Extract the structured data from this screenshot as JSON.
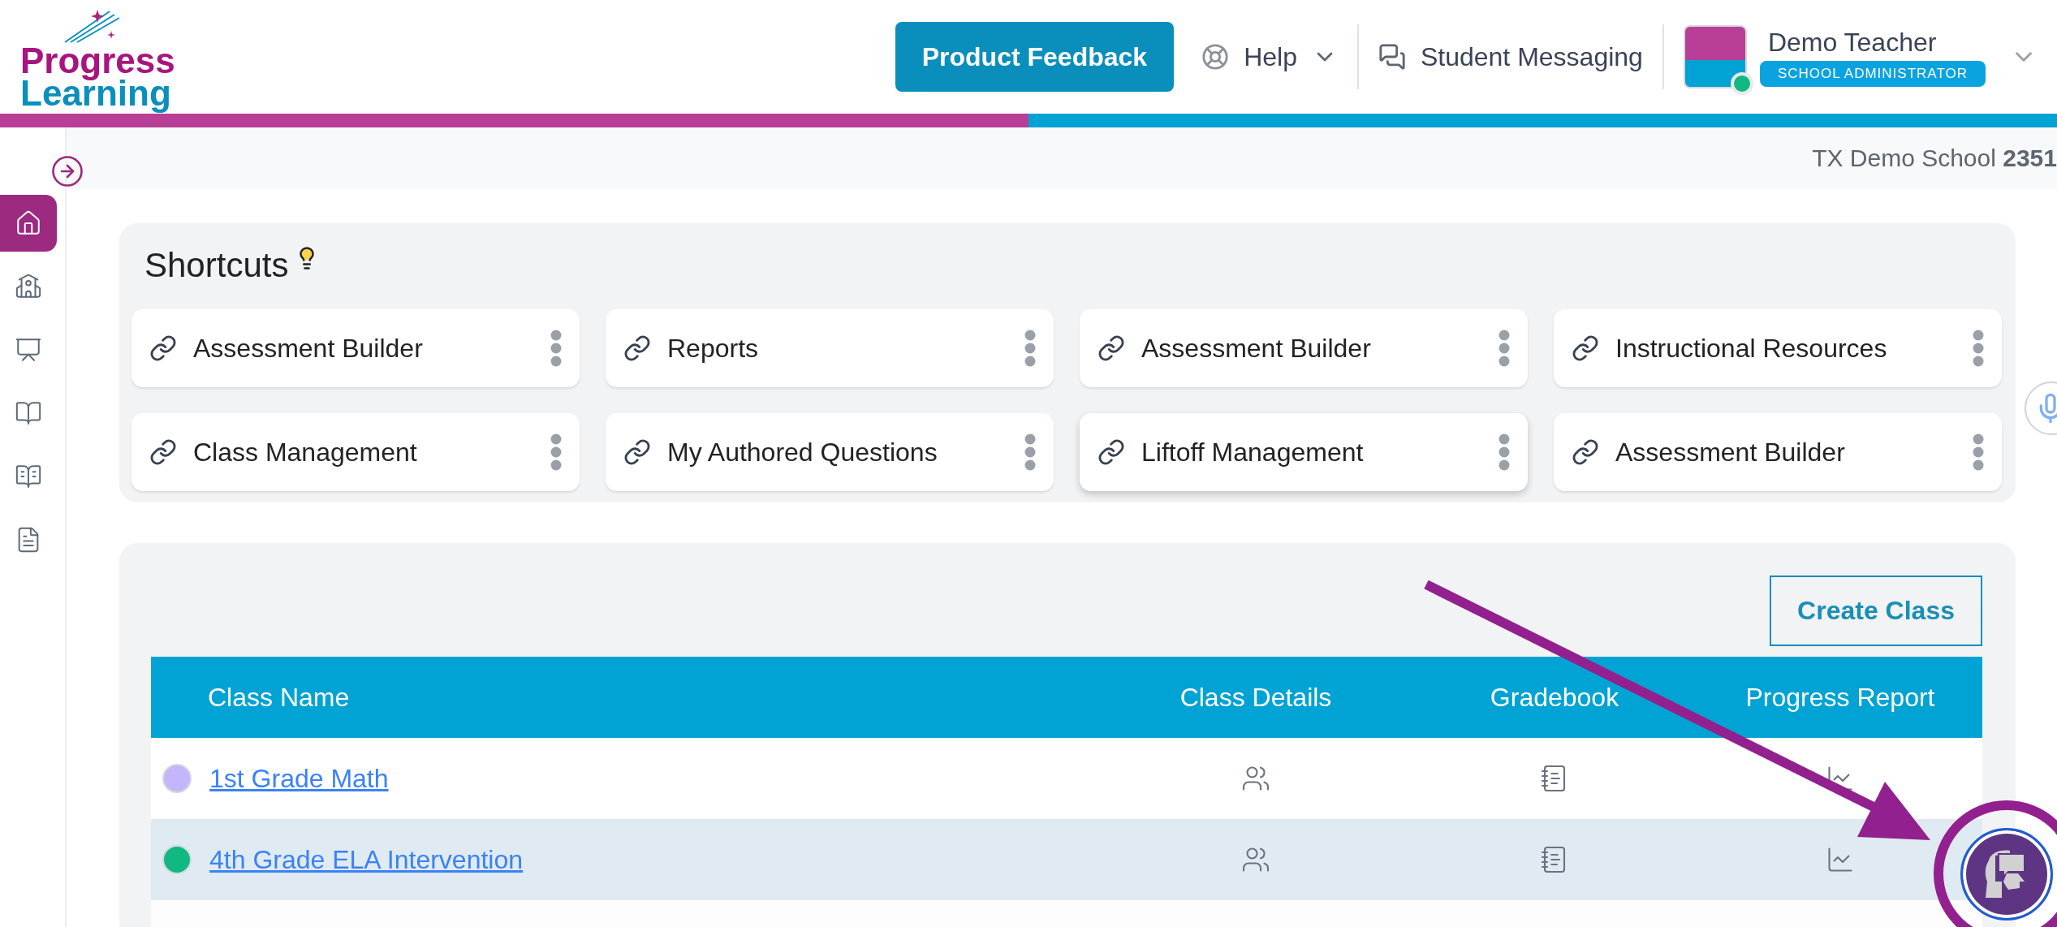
{
  "logo": {
    "line_1": "Progress",
    "line_2": "Learning"
  },
  "header": {
    "feedback_button": "Product Feedback",
    "help": "Help",
    "messaging": "Student Messaging",
    "user": {
      "name": "Demo Teacher",
      "role": "SCHOOL ADMINISTRATOR",
      "online": true
    }
  },
  "school": {
    "name": "TX Demo School",
    "id": "2351"
  },
  "sidebar": {
    "items": [
      {
        "kind": "home",
        "selected": true
      },
      {
        "kind": "school",
        "selected": false
      },
      {
        "kind": "classes",
        "selected": false
      },
      {
        "kind": "book",
        "selected": false
      },
      {
        "kind": "guide",
        "selected": false
      },
      {
        "kind": "report",
        "selected": false
      }
    ]
  },
  "shortcuts": {
    "title": "Shortcuts",
    "items": [
      {
        "label": "Assessment Builder",
        "hovered": false
      },
      {
        "label": "Reports",
        "hovered": false
      },
      {
        "label": "Assessment Builder",
        "hovered": false
      },
      {
        "label": "Instructional Resources",
        "hovered": false
      },
      {
        "label": "Class Management",
        "hovered": false
      },
      {
        "label": "My Authored Questions",
        "hovered": false
      },
      {
        "label": "Liftoff Management",
        "hovered": true
      },
      {
        "label": "Assessment Builder",
        "hovered": false
      }
    ]
  },
  "classes": {
    "create_button": "Create Class",
    "columns": [
      "Class Name",
      "Class Details",
      "Gradebook",
      "Progress Report"
    ],
    "rows": [
      {
        "name": "1st Grade Math",
        "color": "#c4b5fd",
        "highlighted": false
      },
      {
        "name": "4th Grade ELA Intervention",
        "color": "#10b981",
        "highlighted": true
      }
    ]
  }
}
